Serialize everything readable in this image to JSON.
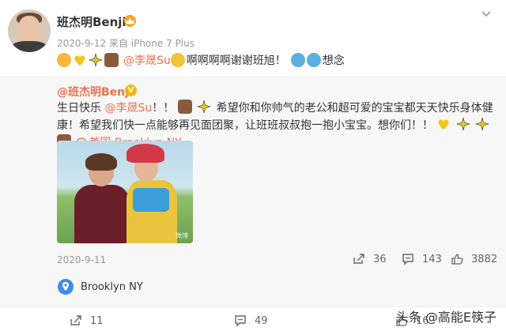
{
  "post": {
    "username": "班杰明Benji",
    "date": "2020-9-12",
    "source": "来自 iPhone 7 Plus",
    "mention": "@李晟Su",
    "text_after": "啊啊啊啊谢谢班旭！",
    "text_end": "想念"
  },
  "quoted": {
    "username": "@班杰明Benji",
    "text_part1": "生日快乐 ",
    "mention": "@李晟Su",
    "text_part2": "！！",
    "text_part3": " 希望你和你帅气的老公和超可爱的宝宝都天天快乐身体健康！希望我们快一点能够再见面团聚，让班班叔叔抱一抱小宝宝。想你们！！",
    "location": "美国·Brooklyn NY",
    "date": "2020-9-11",
    "reposts": "36",
    "comments": "143",
    "likes": "3882",
    "photo_watermark": "微博"
  },
  "place": "Brooklyn NY",
  "bottom": {
    "reposts": "11",
    "comments": "49",
    "likes": "16"
  },
  "watermark": "头条 @高能E筷子",
  "colors": {
    "accent": "#eb7350",
    "gray": "#999999",
    "bg_quote": "#f7f7f7"
  }
}
